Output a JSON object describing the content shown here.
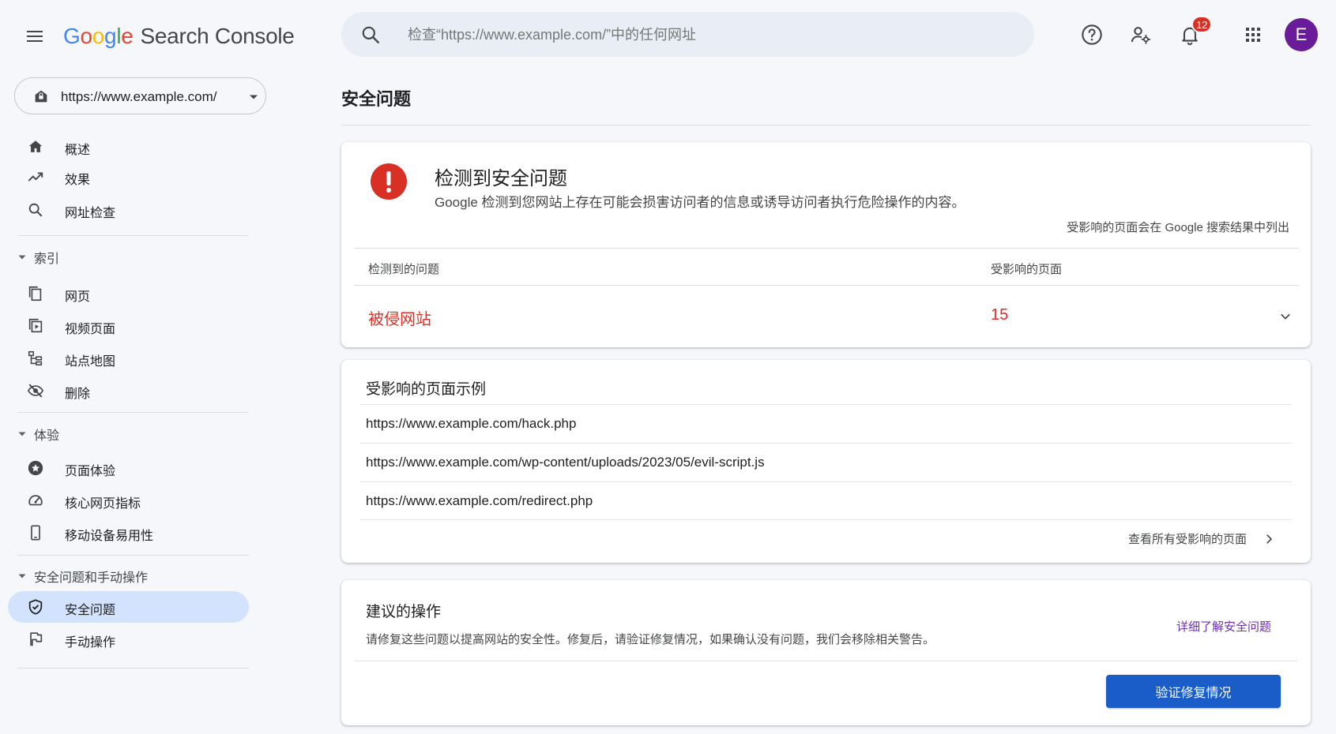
{
  "app": {
    "logo_google": [
      "G",
      "o",
      "o",
      "g",
      "l",
      "e"
    ],
    "logo_product": "Search Console"
  },
  "search": {
    "placeholder": "检查“https://www.example.com/”中的任何网址"
  },
  "header": {
    "notification_count": "12",
    "avatar_letter": "E",
    "avatar_color": "#6a1b9a"
  },
  "property": {
    "url": "https://www.example.com/"
  },
  "sidebar": {
    "items_top": [
      {
        "label": "概述",
        "icon": "home-icon"
      },
      {
        "label": "效果",
        "icon": "trending-up-icon"
      },
      {
        "label": "网址检查",
        "icon": "search-icon"
      }
    ],
    "sections": [
      {
        "label": "索引",
        "items": [
          {
            "label": "网页",
            "icon": "pages-icon"
          },
          {
            "label": "视频页面",
            "icon": "video-page-icon"
          },
          {
            "label": "站点地图",
            "icon": "sitemap-icon"
          },
          {
            "label": "删除",
            "icon": "visibility-off-icon"
          }
        ]
      },
      {
        "label": "体验",
        "items": [
          {
            "label": "页面体验",
            "icon": "star-circle-icon"
          },
          {
            "label": "核心网页指标",
            "icon": "speed-gauge-icon"
          },
          {
            "label": "移动设备易用性",
            "icon": "mobile-icon"
          }
        ]
      },
      {
        "label": "安全问题和手动操作",
        "items": [
          {
            "label": "安全问题",
            "icon": "shield-icon",
            "active": true
          },
          {
            "label": "手动操作",
            "icon": "flag-icon"
          }
        ]
      }
    ]
  },
  "main": {
    "page_title": "安全问题",
    "summary_card": {
      "title": "检测到安全问题",
      "description": "Google 检测到您网站上存在可能会损害访问者的信息或诱导访问者执行危险操作的内容。",
      "note": "受影响的页面会在 Google 搜索结果中列出",
      "col_issue": "检测到的问题",
      "col_pages": "受影响的页面",
      "issue": "被侵网站",
      "count": "15",
      "alert_color": "#d93025"
    },
    "examples_card": {
      "title": "受影响的页面示例",
      "urls": [
        "https://www.example.com/hack.php",
        "https://www.example.com/wp-content/uploads/2023/05/evil-script.js",
        "https://www.example.com/redirect.php"
      ],
      "view_all": "查看所有受影响的页面"
    },
    "actions_card": {
      "title": "建议的操作",
      "description": "请修复这些问题以提高网站的安全性。修复后，请验证修复情况，如果确认没有问题，我们会移除相关警告。",
      "learn_more": "详细了解安全问题",
      "verify_button": "验证修复情况",
      "button_color": "#1a5dc9"
    }
  }
}
